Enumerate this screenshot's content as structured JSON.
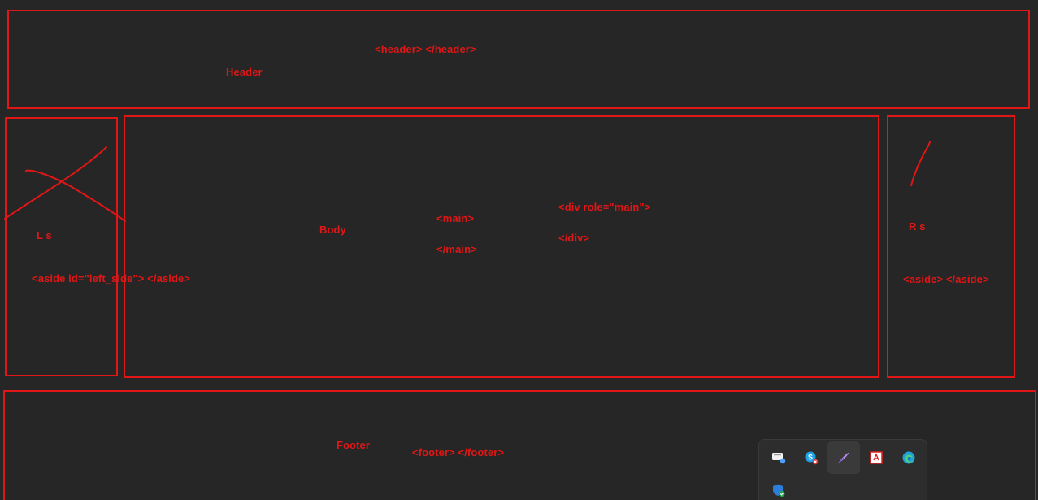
{
  "header": {
    "tag_label": "<header> </header>",
    "name_label": "Header"
  },
  "left_side": {
    "name_label": "L s",
    "tag_label": "<aside id=\"left_side\"> </aside>"
  },
  "body": {
    "name_label": "Body",
    "main_open": "<main>",
    "main_close": "</main>",
    "div_open": "<div role=\"main\">",
    "div_close": "</div>"
  },
  "right_side": {
    "name_label": "R s",
    "tag_label": "<aside> </aside>"
  },
  "footer": {
    "name_label": "Footer",
    "tag_label": "<footer> </footer>"
  },
  "tray": {
    "icons": [
      "chat-window-icon",
      "skype-icon",
      "quill-icon",
      "pdf-icon",
      "edge-icon",
      "security-shield-icon"
    ]
  },
  "colors": {
    "background": "#262626",
    "annotation": "#e11616"
  }
}
